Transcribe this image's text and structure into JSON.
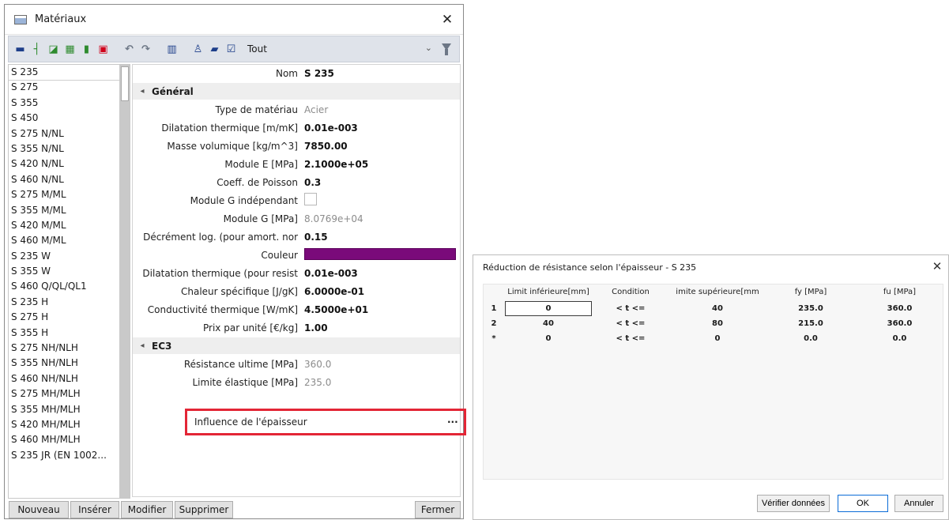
{
  "materials_window": {
    "title": "Matériaux",
    "close_glyph": "✕",
    "toolbar": {
      "filter_label": "Tout",
      "dropdown_glyph": "⌄",
      "icons": [
        "new-material-icon",
        "insert-icon",
        "edit-icon",
        "library-icon",
        "import-icon",
        "delete-icon",
        "undo-icon",
        "redo-icon",
        "table-icon",
        "users-icon",
        "save-icon",
        "check-icon",
        "filter-icon"
      ],
      "colors": {
        "green": "#2e8b2e",
        "red": "#d0021b",
        "blue": "#1e3f8a",
        "gray": "#6d7786"
      }
    },
    "list": [
      "S 235",
      "S 275",
      "S 355",
      "S 450",
      "S 275 N/NL",
      "S 355 N/NL",
      "S 420 N/NL",
      "S 460 N/NL",
      "S 275 M/ML",
      "S 355 M/ML",
      "S 420 M/ML",
      "S 460 M/ML",
      "S 235 W",
      "S 355 W",
      "S 460 Q/QL/QL1",
      "S 235 H",
      "S 275 H",
      "S 355 H",
      "S 275 NH/NLH",
      "S 355 NH/NLH",
      "S 460 NH/NLH",
      "S 275 MH/MLH",
      "S 355 MH/MLH",
      "S 420 MH/MLH",
      "S 460 MH/MLH",
      "S 235 JR (EN 1002..."
    ],
    "selected_index": 0,
    "properties": {
      "name_label": "Nom",
      "name_value": "S 235",
      "general_label": "Général",
      "ec3_label": "EC3",
      "section_caret": "◂",
      "material_type_label": "Type de matériau",
      "material_type_value": "Acier",
      "thermal_dilatation_label": "Dilatation thermique  [m/mK]",
      "thermal_dilatation_value": "0.01e-003",
      "density_label": "Masse volumique [kg/m^3]",
      "density_value": "7850.00",
      "modulus_e_label": "Module E [MPa]",
      "modulus_e_value": "2.1000e+05",
      "poisson_label": "Coeff. de Poisson",
      "poisson_value": "0.3",
      "modulus_g_indep_label": "Module G indépendant",
      "modulus_g_label": "Module G [MPa]",
      "modulus_g_value": "8.0769e+04",
      "log_decrement_label": "Décrément log. (pour amort. nor",
      "log_decrement_value": "0.15",
      "color_label": "Couleur",
      "color_value": "#7a0a7a",
      "thermal_dilatation_fire_label": "Dilatation thermique (pour resist",
      "thermal_dilatation_fire_value": "0.01e-003",
      "specific_heat_label": "Chaleur spécifique [J/gK]",
      "specific_heat_value": "6.0000e-01",
      "conductivity_label": "Conductivité thermique [W/mK]",
      "conductivity_value": "4.5000e+01",
      "unit_price_label": "Prix par unité [€/kg]",
      "unit_price_value": "1.00",
      "ultimate_strength_label": "Résistance ultime [MPa]",
      "ultimate_strength_value": "360.0",
      "yield_strength_label": "Limite élastique [MPa]",
      "yield_strength_value": "235.0",
      "thickness_influence_label": "Influence de l'épaisseur",
      "ellipsis": "..."
    },
    "buttons": {
      "new": "Nouveau",
      "insert": "Insérer",
      "modify": "Modifier",
      "delete": "Supprimer",
      "close": "Fermer"
    },
    "highlight_color": "#e32636"
  },
  "reduction_dialog": {
    "title": "Réduction de résistance selon l'épaisseur - S 235",
    "close_glyph": "✕",
    "columns": [
      "",
      "Limit inférieure[mm]",
      "Condition",
      "imite supérieure[mm",
      "fy [MPa]",
      "fu [MPa]"
    ],
    "rows": [
      [
        "1",
        "0",
        "< t <=",
        "40",
        "235.0",
        "360.0"
      ],
      [
        "2",
        "40",
        "< t <=",
        "80",
        "215.0",
        "360.0"
      ],
      [
        "*",
        "0",
        "< t <=",
        "0",
        "0.0",
        "0.0"
      ]
    ],
    "buttons": {
      "verify": "Vérifier données",
      "ok": "OK",
      "cancel": "Annuler"
    }
  }
}
